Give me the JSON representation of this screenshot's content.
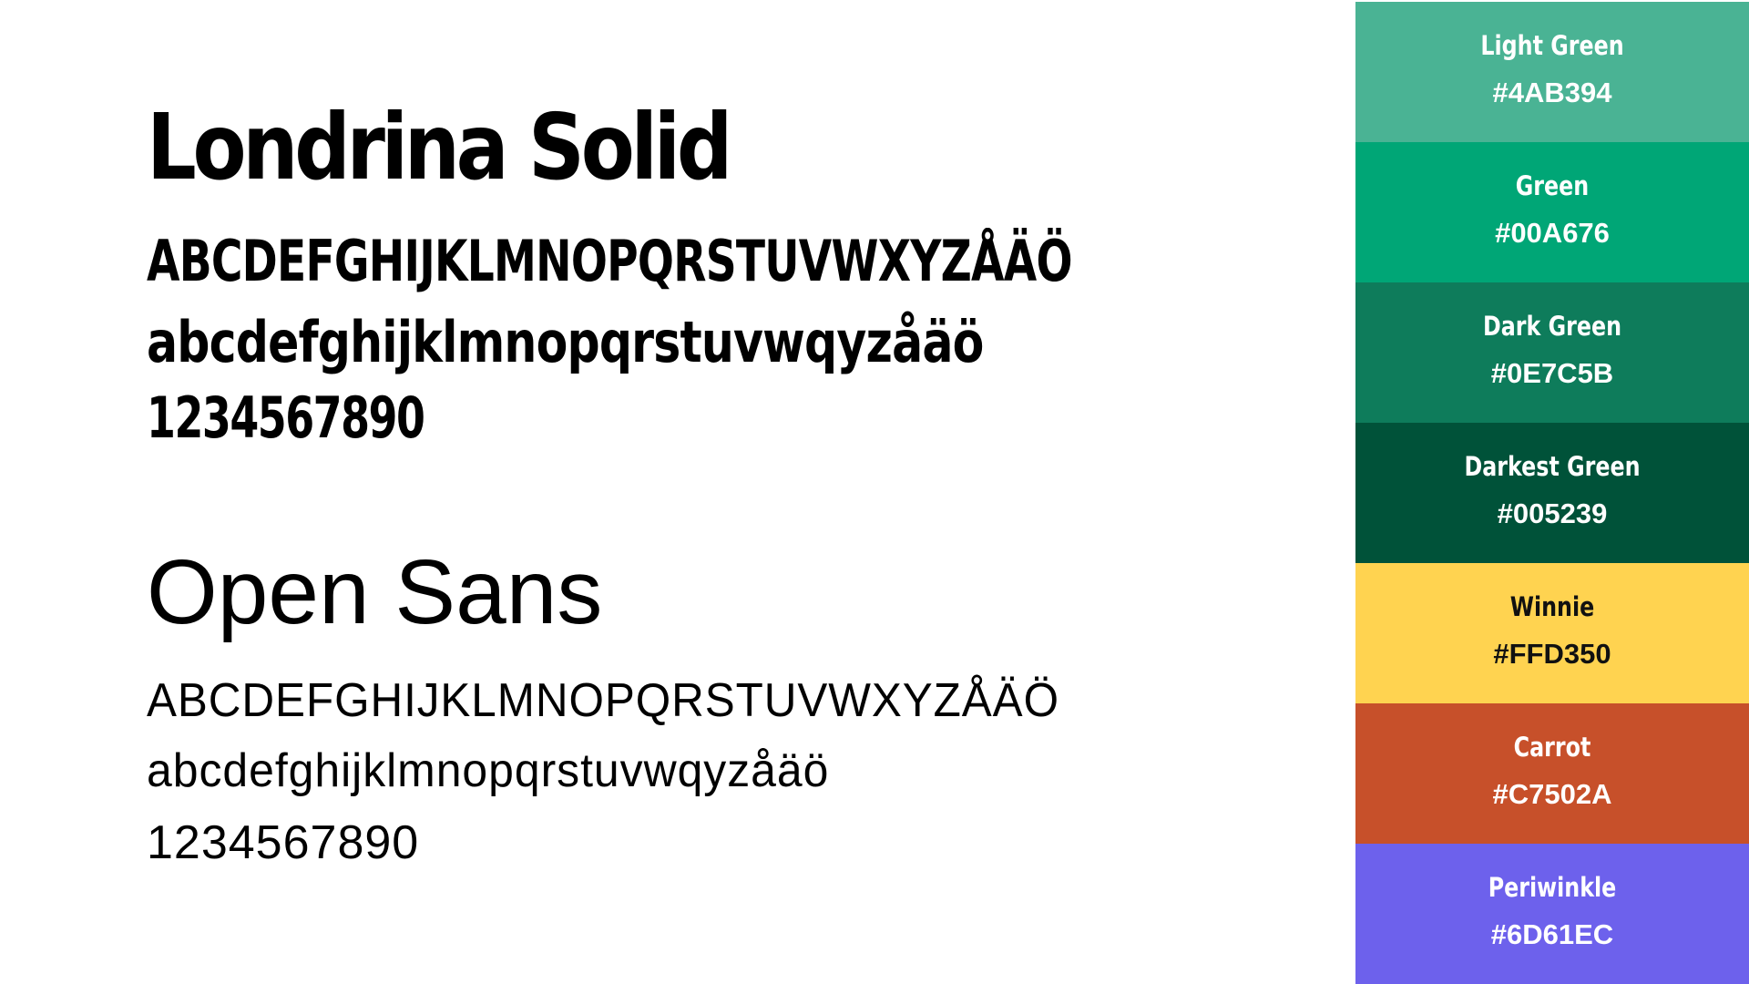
{
  "typography": {
    "display_font": {
      "name": "Londrina Solid",
      "uppercase": "ABCDEFGHIJKLMNOPQRSTUVWXYZÅÄÖ",
      "lowercase": "abcdefghijklmnopqrstuvwqyzåäö",
      "digits": "1234567890"
    },
    "body_font": {
      "name": "Open Sans",
      "uppercase": "ABCDEFGHIJKLMNOPQRSTUVWXYZÅÄÖ",
      "lowercase": "abcdefghijklmnopqrstuvwqyzåäö",
      "digits": "1234567890"
    }
  },
  "palette": [
    {
      "name": "Light Green",
      "hex": "#4AB394",
      "color": "#4AB394",
      "text_color": "#FFFFFF"
    },
    {
      "name": "Green",
      "hex": "#00A676",
      "color": "#00A676",
      "text_color": "#FFFFFF"
    },
    {
      "name": "Dark Green",
      "hex": "#0E7C5B",
      "color": "#0E7C5B",
      "text_color": "#FFFFFF"
    },
    {
      "name": "Darkest Green",
      "hex": "#005239",
      "color": "#005239",
      "text_color": "#FFFFFF"
    },
    {
      "name": "Winnie",
      "hex": "#FFD350",
      "color": "#FFD350",
      "text_color": "#111111"
    },
    {
      "name": "Carrot",
      "hex": "#C7502A",
      "color": "#C7502A",
      "text_color": "#FFFFFF"
    },
    {
      "name": "Periwinkle",
      "hex": "#6D61EC",
      "color": "#6D61EC",
      "text_color": "#FFFFFF"
    }
  ]
}
